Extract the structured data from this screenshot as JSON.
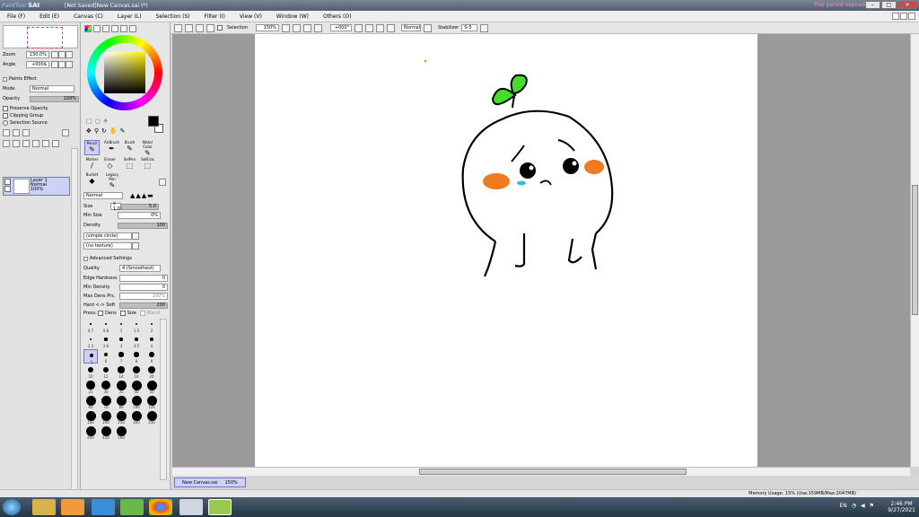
{
  "window": {
    "app_logo": "PaintTool",
    "app_logo_sai": "SAI",
    "title": "[Not Saved]New Canvas.sai (*)",
    "trial_notice": "Trial period expired"
  },
  "menu": [
    "File (F)",
    "Edit (E)",
    "Canvas (C)",
    "Layer (L)",
    "Selection (S)",
    "Filter (I)",
    "View (V)",
    "Window (W)",
    "Others (O)"
  ],
  "navigator": {
    "zoom_label": "Zoom",
    "zoom_value": "150.0%",
    "angle_label": "Angle",
    "angle_value": "+000$"
  },
  "layer_panel": {
    "paints_effect": "Paints Effect",
    "mode_label": "Mode",
    "mode_value": "Normal",
    "opacity_label": "Opacity",
    "opacity_value": "100%",
    "preserve_opacity": "Preserve Opacity",
    "clipping_group": "Clipping Group",
    "selection_source": "Selection Source",
    "layer_name": "Layer 1",
    "layer_mode": "Normal",
    "layer_opacity": "100%"
  },
  "tools": {
    "pencil": "Pencil",
    "airbrush": "AirBrush",
    "brush": "Brush",
    "water_color": "Water Color",
    "marker": "Marker",
    "eraser": "Eraser",
    "select_pen": "SelPen",
    "select_eraser": "SelEras",
    "bucket": "Bucket",
    "legacy_pen": "Legacy Pen"
  },
  "brush_settings": {
    "blend_mode": "Normal",
    "size_label": "Size",
    "size_mult": "x 1.0",
    "size_value": "5.0",
    "min_size_label": "Min Size",
    "min_size_value": "0%",
    "density_label": "Density",
    "density_value": "100",
    "shape": "(simple circle)",
    "texture": "(no texture)",
    "advanced_label": "Advanced Settings",
    "quality_label": "Quality",
    "quality_value": "4 (Smoothest)",
    "edge_hardness_label": "Edge Hardness",
    "edge_hardness_value": "0",
    "min_density_label": "Min Density",
    "min_density_value": "0",
    "max_dens_prs_label": "Max Dens Prs.",
    "max_dens_prs_value": "100%",
    "hard_soft_label": "Hard <-> Soft",
    "hard_soft_value": "200",
    "press_label": "Press:",
    "press_dens": "Dens",
    "press_size": "Size",
    "press_blend": "Blend"
  },
  "brush_sizes": [
    "0.7",
    "0.8",
    "1",
    "1.5",
    "2",
    "2.3",
    "2.6",
    "3",
    "3.5",
    "4",
    "5",
    "6",
    "7",
    "8",
    "9",
    "10",
    "12",
    "14",
    "16",
    "20",
    "25",
    "30",
    "35",
    "40",
    "50",
    "60",
    "70",
    "80",
    "100",
    "120",
    "160",
    "200",
    "250",
    "300",
    "350",
    "400",
    "450",
    "500"
  ],
  "canvas_toolbar": {
    "selection_label": "Selection",
    "zoom": "150%",
    "angle": "+000°",
    "mode": "Normal",
    "stabilizer_label": "Stabilizer",
    "stabilizer_value": "S-5"
  },
  "tab": {
    "name": "New Canvas.sai",
    "zoom": "150%"
  },
  "status": {
    "memory": "Memory Usage: 15% (Use:159MB/Max:2047MB)"
  },
  "taskbar": {
    "lang": "EN",
    "time": "2:46 PM",
    "date": "9/27/2021"
  },
  "colors": {
    "accent": "#cdd1f5",
    "accent_border": "#6e77c9",
    "sprout_green": "#44dd2a",
    "cheek_orange": "#f07a1e",
    "tear_blue": "#33bde8",
    "trial_pink": "#ff8ca8"
  }
}
